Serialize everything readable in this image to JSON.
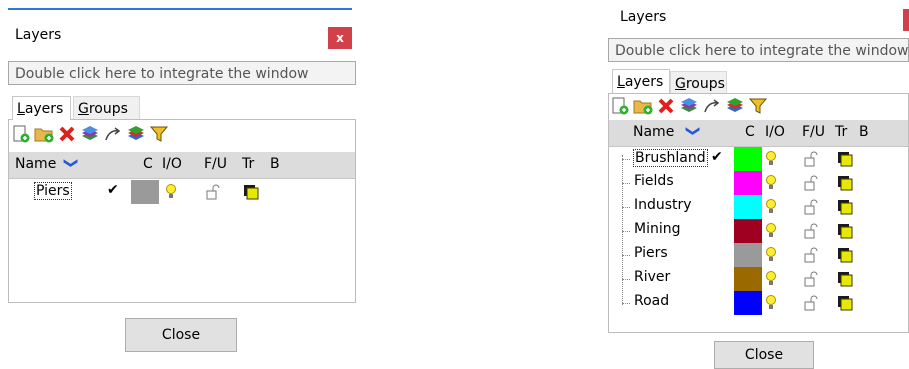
{
  "left": {
    "title": "Layers",
    "close_x": "x",
    "integrate_text": "Double click here to integrate the window",
    "tabs": [
      {
        "label_u": "L",
        "label_rest": "ayers"
      },
      {
        "label_u": "G",
        "label_rest": "roups"
      }
    ],
    "header": {
      "name": "Name",
      "c": "C",
      "io": "I/O",
      "fu": "F/U",
      "tr": "Tr",
      "b": "B"
    },
    "layers": [
      {
        "name": "Piers",
        "checked": "✔",
        "color": "#9a9a9a"
      }
    ],
    "close_button": "Close"
  },
  "right": {
    "title": "Layers",
    "close_x": "x",
    "integrate_text": "Double click here to integrate the window",
    "tabs": [
      {
        "label_u": "L",
        "label_rest": "ayers"
      },
      {
        "label_u": "G",
        "label_rest": "roups"
      }
    ],
    "header": {
      "name": "Name",
      "c": "C",
      "io": "I/O",
      "fu": "F/U",
      "tr": "Tr",
      "b": "B"
    },
    "layers": [
      {
        "name": "Brushland",
        "checked": "✔",
        "color": "#00ff00"
      },
      {
        "name": "Fields",
        "checked": "",
        "color": "#ff00ff"
      },
      {
        "name": "Industry",
        "checked": "",
        "color": "#00ffff"
      },
      {
        "name": "Mining",
        "checked": "",
        "color": "#a00020"
      },
      {
        "name": "Piers",
        "checked": "",
        "color": "#9a9a9a"
      },
      {
        "name": "River",
        "checked": "",
        "color": "#9a6a00"
      },
      {
        "name": "Road",
        "checked": "",
        "color": "#0000ff"
      }
    ],
    "close_button": "Close"
  },
  "icons": [
    "new-layer-icon",
    "add-layer-icon",
    "delete-layer-icon",
    "layers-stack-icon",
    "link-arrow-icon",
    "layers-color-icon",
    "filter-icon"
  ]
}
